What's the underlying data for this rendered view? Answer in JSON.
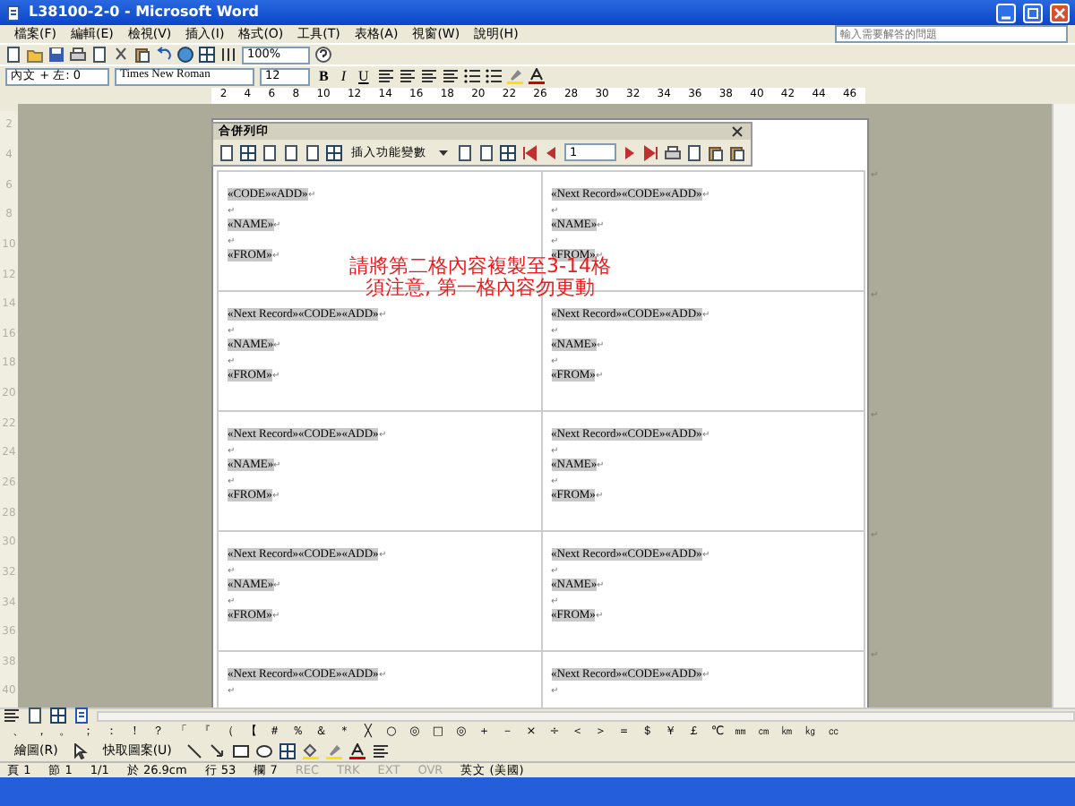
{
  "window": {
    "title": "L38100-2-0 - Microsoft Word"
  },
  "menu": [
    "檔案(F)",
    "編輯(E)",
    "檢視(V)",
    "插入(I)",
    "格式(O)",
    "工具(T)",
    "表格(A)",
    "視窗(W)",
    "說明(H)"
  ],
  "help_search": {
    "placeholder": "輸入需要解答的問題"
  },
  "standard_toolbar": {
    "zoom": "100%"
  },
  "formatting_toolbar": {
    "style": "內文 + 左: 0",
    "font": "Times New Roman",
    "size": "12",
    "bold": "B",
    "italic": "I",
    "underline": "U"
  },
  "ruler": [
    "2",
    "4",
    "6",
    "8",
    "10",
    "12",
    "14",
    "16",
    "18",
    "20",
    "22",
    "26",
    "28",
    "30",
    "32",
    "34",
    "36",
    "38",
    "40",
    "42",
    "44",
    "46"
  ],
  "vertical_ruler": [
    "2",
    "4",
    "6",
    "8",
    "10",
    "12",
    "14",
    "16",
    "18",
    "20",
    "22",
    "24",
    "26",
    "28",
    "30",
    "32",
    "34",
    "36",
    "38",
    "40"
  ],
  "mail_merge_toolbar": {
    "title": "合併列印",
    "insert_field": "插入功能變數",
    "record": "1"
  },
  "table": {
    "rows": [
      {
        "end_mark": "↵",
        "cells": [
          {
            "lines": [
              {
                "field": "«CODE»«ADD»",
                "mark": "↵"
              },
              {
                "mark": "↵"
              },
              {
                "field": "«NAME»",
                "mark": "↵"
              },
              {
                "mark": "↵"
              },
              {
                "field": "«FROM»",
                "mark": "↵"
              }
            ]
          },
          {
            "lines": [
              {
                "field": "«Next Record»«CODE»«ADD»",
                "mark": "↵"
              },
              {
                "mark": "↵"
              },
              {
                "field": "«NAME»",
                "mark": "↵"
              },
              {
                "mark": "↵"
              },
              {
                "field": "«FROM»",
                "mark": "↵"
              }
            ]
          }
        ]
      },
      {
        "end_mark": "↵",
        "cells": [
          {
            "lines": [
              {
                "field": "«Next Record»«CODE»«ADD»",
                "mark": "↵"
              },
              {
                "mark": "↵"
              },
              {
                "field": "«NAME»",
                "mark": "↵"
              },
              {
                "mark": "↵"
              },
              {
                "field": "«FROM»",
                "mark": "↵"
              }
            ]
          },
          {
            "lines": [
              {
                "field": "«Next Record»«CODE»«ADD»",
                "mark": "↵"
              },
              {
                "mark": "↵"
              },
              {
                "field": "«NAME»",
                "mark": "↵"
              },
              {
                "mark": "↵"
              },
              {
                "field": "«FROM»",
                "mark": "↵"
              }
            ]
          }
        ]
      },
      {
        "end_mark": "↵",
        "cells": [
          {
            "lines": [
              {
                "field": "«Next Record»«CODE»«ADD»",
                "mark": "↵"
              },
              {
                "mark": "↵"
              },
              {
                "field": "«NAME»",
                "mark": "↵"
              },
              {
                "mark": "↵"
              },
              {
                "field": "«FROM»",
                "mark": "↵"
              }
            ]
          },
          {
            "lines": [
              {
                "field": "«Next Record»«CODE»«ADD»",
                "mark": "↵"
              },
              {
                "mark": "↵"
              },
              {
                "field": "«NAME»",
                "mark": "↵"
              },
              {
                "mark": "↵"
              },
              {
                "field": "«FROM»",
                "mark": "↵"
              }
            ]
          }
        ]
      },
      {
        "end_mark": "↵",
        "cells": [
          {
            "lines": [
              {
                "field": "«Next Record»«CODE»«ADD»",
                "mark": "↵"
              },
              {
                "mark": "↵"
              },
              {
                "field": "«NAME»",
                "mark": "↵"
              },
              {
                "mark": "↵"
              },
              {
                "field": "«FROM»",
                "mark": "↵"
              }
            ]
          },
          {
            "lines": [
              {
                "field": "«Next Record»«CODE»«ADD»",
                "mark": "↵"
              },
              {
                "mark": "↵"
              },
              {
                "field": "«NAME»",
                "mark": "↵"
              },
              {
                "mark": "↵"
              },
              {
                "field": "«FROM»",
                "mark": "↵"
              }
            ]
          }
        ]
      },
      {
        "end_mark": "↵",
        "cells": [
          {
            "lines": [
              {
                "field": "«Next Record»«CODE»«ADD»",
                "mark": "↵"
              },
              {
                "mark": "↵"
              }
            ]
          },
          {
            "lines": [
              {
                "field": "«Next Record»«CODE»«ADD»",
                "mark": "↵"
              },
              {
                "mark": "↵"
              }
            ]
          }
        ]
      }
    ]
  },
  "annotation": [
    "請將第二格內容複製至3-14格",
    "須注意, 第一格內容勿更動"
  ],
  "symbol_toolbar": [
    "、",
    "，",
    "。",
    "；",
    "：",
    "！",
    "？",
    "「",
    "『",
    "（",
    "【",
    "＃",
    "％",
    "＆",
    "＊",
    "╳",
    "○",
    "◎",
    "□",
    "◎",
    "＋",
    "－",
    "×",
    "÷",
    "＜",
    "＞",
    "＝",
    "＄",
    "￥",
    "￡",
    "℃",
    "㎜",
    "㎝",
    "㎞",
    "㎏",
    "㏄"
  ],
  "drawing_toolbar": {
    "draw_menu": "繪圖(R)",
    "autoshapes_menu": "快取圖案(U)"
  },
  "status_bar": [
    {
      "text": "頁 1",
      "disabled": false
    },
    {
      "text": "節 1",
      "disabled": false
    },
    {
      "text": "1/1",
      "disabled": false
    },
    {
      "text": "於 26.9cm",
      "disabled": false
    },
    {
      "text": "行 53",
      "disabled": false
    },
    {
      "text": "欄 7",
      "disabled": false
    },
    {
      "text": "REC",
      "disabled": true
    },
    {
      "text": "TRK",
      "disabled": true
    },
    {
      "text": "EXT",
      "disabled": true
    },
    {
      "text": "OVR",
      "disabled": true
    },
    {
      "text": "英文 (美國)",
      "disabled": false
    }
  ]
}
